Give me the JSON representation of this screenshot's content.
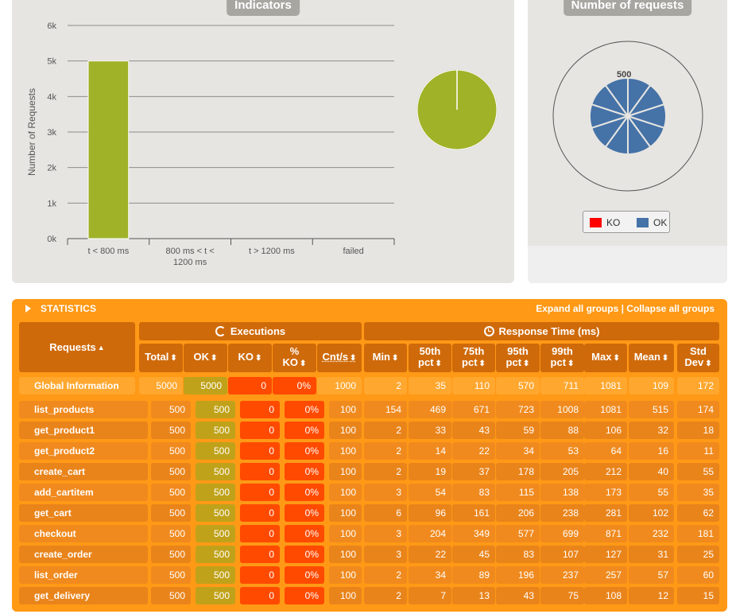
{
  "indicators": {
    "title": "Indicators",
    "y_axis_label": "Number of Requests",
    "y_ticks": [
      "0k",
      "1k",
      "2k",
      "3k",
      "4k",
      "5k",
      "6k"
    ],
    "categories": [
      {
        "label_lines": [
          "t < 800 ms"
        ]
      },
      {
        "label_lines": [
          "800 ms < t <",
          "1200 ms"
        ]
      },
      {
        "label_lines": [
          "t > 1200 ms"
        ]
      },
      {
        "label_lines": [
          "failed"
        ]
      }
    ],
    "pie_color": "#a0b228"
  },
  "requests_chart": {
    "title": "Number of requests",
    "center_label": "500",
    "legend": [
      {
        "name": "KO",
        "color": "#ff0000"
      },
      {
        "name": "OK",
        "color": "#4572a7"
      }
    ]
  },
  "chart_data": [
    {
      "type": "bar",
      "title": "Indicators",
      "ylabel": "Number of Requests",
      "ylim": [
        0,
        6000
      ],
      "categories": [
        "t < 800 ms",
        "800 ms < t < 1200 ms",
        "t > 1200 ms",
        "failed"
      ],
      "values": [
        5000,
        0,
        0,
        0
      ],
      "color": "#a0b228"
    },
    {
      "type": "pie",
      "slices": [
        {
          "label": "t < 800 ms",
          "value": 5000
        }
      ],
      "color": "#a0b228"
    },
    {
      "type": "pie",
      "title": "Number of requests",
      "series": [
        {
          "name": "KO",
          "values": [
            0,
            0,
            0,
            0,
            0,
            0,
            0,
            0,
            0,
            0
          ]
        },
        {
          "name": "OK",
          "values": [
            500,
            500,
            500,
            500,
            500,
            500,
            500,
            500,
            500,
            500
          ]
        }
      ],
      "categories": [
        "list_products",
        "get_product1",
        "get_product2",
        "create_cart",
        "add_cartitem",
        "get_cart",
        "checkout",
        "create_order",
        "list_order",
        "get_delivery"
      ]
    }
  ],
  "statistics": {
    "title": "STATISTICS",
    "expand_label": "Expand all groups",
    "separator": " | ",
    "collapse_label": "Collapse all groups",
    "requests_header": "Requests",
    "executions_header": "Executions",
    "response_time_header": "Response Time (ms)",
    "columns": [
      {
        "lines": [
          "Total"
        ]
      },
      {
        "lines": [
          "OK"
        ]
      },
      {
        "lines": [
          "KO"
        ]
      },
      {
        "lines": [
          "%",
          "KO"
        ]
      },
      {
        "lines": [
          "Cnt/s"
        ]
      },
      {
        "lines": [
          "Min"
        ]
      },
      {
        "lines": [
          "50th",
          "pct"
        ]
      },
      {
        "lines": [
          "75th",
          "pct"
        ]
      },
      {
        "lines": [
          "95th",
          "pct"
        ]
      },
      {
        "lines": [
          "99th",
          "pct"
        ]
      },
      {
        "lines": [
          "Max"
        ]
      },
      {
        "lines": [
          "Mean"
        ]
      },
      {
        "lines": [
          "Std",
          "Dev"
        ]
      }
    ],
    "global": {
      "name": "Global Information",
      "values": [
        "5000",
        "5000",
        "0",
        "0%",
        "1000",
        "2",
        "35",
        "110",
        "570",
        "711",
        "1081",
        "109",
        "172"
      ]
    },
    "rows": [
      {
        "name": "list_products",
        "values": [
          "500",
          "500",
          "0",
          "0%",
          "100",
          "154",
          "469",
          "671",
          "723",
          "1008",
          "1081",
          "515",
          "174"
        ]
      },
      {
        "name": "get_product1",
        "values": [
          "500",
          "500",
          "0",
          "0%",
          "100",
          "2",
          "33",
          "43",
          "59",
          "88",
          "106",
          "32",
          "18"
        ]
      },
      {
        "name": "get_product2",
        "values": [
          "500",
          "500",
          "0",
          "0%",
          "100",
          "2",
          "14",
          "22",
          "34",
          "53",
          "64",
          "16",
          "11"
        ]
      },
      {
        "name": "create_cart",
        "values": [
          "500",
          "500",
          "0",
          "0%",
          "100",
          "2",
          "19",
          "37",
          "178",
          "205",
          "212",
          "40",
          "55"
        ]
      },
      {
        "name": "add_cartitem",
        "values": [
          "500",
          "500",
          "0",
          "0%",
          "100",
          "3",
          "54",
          "83",
          "115",
          "138",
          "173",
          "55",
          "35"
        ]
      },
      {
        "name": "get_cart",
        "values": [
          "500",
          "500",
          "0",
          "0%",
          "100",
          "6",
          "96",
          "161",
          "206",
          "238",
          "281",
          "102",
          "62"
        ]
      },
      {
        "name": "checkout",
        "values": [
          "500",
          "500",
          "0",
          "0%",
          "100",
          "3",
          "204",
          "349",
          "577",
          "699",
          "871",
          "232",
          "181"
        ]
      },
      {
        "name": "create_order",
        "values": [
          "500",
          "500",
          "0",
          "0%",
          "100",
          "3",
          "22",
          "45",
          "83",
          "107",
          "127",
          "31",
          "25"
        ]
      },
      {
        "name": "list_order",
        "values": [
          "500",
          "500",
          "0",
          "0%",
          "100",
          "2",
          "34",
          "89",
          "196",
          "237",
          "257",
          "57",
          "60"
        ]
      },
      {
        "name": "get_delivery",
        "values": [
          "500",
          "500",
          "0",
          "0%",
          "100",
          "2",
          "7",
          "13",
          "43",
          "75",
          "108",
          "12",
          "15"
        ]
      }
    ]
  }
}
